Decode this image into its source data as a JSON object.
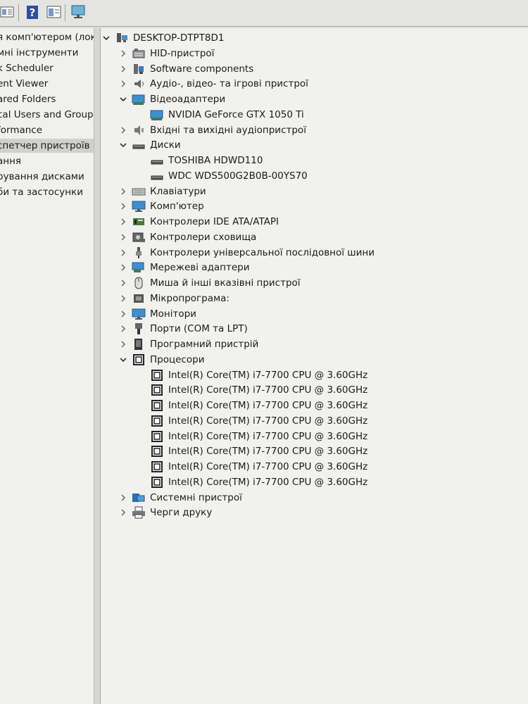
{
  "left_nav": {
    "items": [
      {
        "label": "я комп'ютером (лок"
      },
      {
        "label": "мні інструменти"
      },
      {
        "label": "k Scheduler"
      },
      {
        "label": "ent Viewer"
      },
      {
        "label": "ared Folders"
      },
      {
        "label": "cal Users and Groups"
      },
      {
        "label": "formance"
      },
      {
        "label": "спетчер пристроїв"
      },
      {
        "label": "ання"
      },
      {
        "label": "рування дисками"
      },
      {
        "label": "би та застосунки"
      }
    ],
    "selected_index": 7
  },
  "tree": {
    "root": {
      "label": "DESKTOP-DTPT8D1",
      "icon": "computer-icon"
    },
    "categories": [
      {
        "label": "HID-пристрої",
        "icon": "hid-icon",
        "expanded": false
      },
      {
        "label": "Software components",
        "icon": "software-components-icon",
        "expanded": false
      },
      {
        "label": "Аудіо-, відео- та ігрові пристрої",
        "icon": "audio-icon",
        "expanded": false
      },
      {
        "label": "Відеоадаптери",
        "icon": "display-adapter-icon",
        "expanded": true,
        "children": [
          {
            "label": "NVIDIA GeForce GTX 1050 Ti",
            "icon": "display-adapter-icon"
          }
        ]
      },
      {
        "label": "Вхідні та вихідні аудіопристрої",
        "icon": "speaker-icon",
        "expanded": false
      },
      {
        "label": "Диски",
        "icon": "disk-icon",
        "expanded": true,
        "children": [
          {
            "label": "TOSHIBA HDWD110",
            "icon": "disk-icon"
          },
          {
            "label": "WDC WDS500G2B0B-00YS70",
            "icon": "disk-icon"
          }
        ]
      },
      {
        "label": "Клавіатури",
        "icon": "keyboard-icon",
        "expanded": false
      },
      {
        "label": "Комп'ютер",
        "icon": "monitor-icon",
        "expanded": false
      },
      {
        "label": "Контролери IDE ATA/ATAPI",
        "icon": "ide-controller-icon",
        "expanded": false
      },
      {
        "label": "Контролери сховища",
        "icon": "storage-controller-icon",
        "expanded": false
      },
      {
        "label": "Контролери універсальної послідовної шини",
        "icon": "usb-icon",
        "expanded": false
      },
      {
        "label": "Мережеві адаптери",
        "icon": "network-adapter-icon",
        "expanded": false
      },
      {
        "label": "Миша й інші вказівні пристрої",
        "icon": "mouse-icon",
        "expanded": false
      },
      {
        "label": "Мікропрограма:",
        "icon": "firmware-icon",
        "expanded": false
      },
      {
        "label": "Монітори",
        "icon": "monitor-icon",
        "expanded": false
      },
      {
        "label": "Порти (COM та LPT)",
        "icon": "port-icon",
        "expanded": false
      },
      {
        "label": "Програмний пристрій",
        "icon": "software-device-icon",
        "expanded": false
      },
      {
        "label": "Процесори",
        "icon": "processor-icon",
        "expanded": true,
        "children": [
          {
            "label": "Intel(R) Core(TM) i7-7700 CPU @ 3.60GHz",
            "icon": "processor-icon"
          },
          {
            "label": "Intel(R) Core(TM) i7-7700 CPU @ 3.60GHz",
            "icon": "processor-icon"
          },
          {
            "label": "Intel(R) Core(TM) i7-7700 CPU @ 3.60GHz",
            "icon": "processor-icon"
          },
          {
            "label": "Intel(R) Core(TM) i7-7700 CPU @ 3.60GHz",
            "icon": "processor-icon"
          },
          {
            "label": "Intel(R) Core(TM) i7-7700 CPU @ 3.60GHz",
            "icon": "processor-icon"
          },
          {
            "label": "Intel(R) Core(TM) i7-7700 CPU @ 3.60GHz",
            "icon": "processor-icon"
          },
          {
            "label": "Intel(R) Core(TM) i7-7700 CPU @ 3.60GHz",
            "icon": "processor-icon"
          },
          {
            "label": "Intel(R) Core(TM) i7-7700 CPU @ 3.60GHz",
            "icon": "processor-icon"
          }
        ]
      },
      {
        "label": "Системні пристрої",
        "icon": "system-devices-icon",
        "expanded": false
      },
      {
        "label": "Черги друку",
        "icon": "printer-icon",
        "expanded": false
      }
    ]
  }
}
